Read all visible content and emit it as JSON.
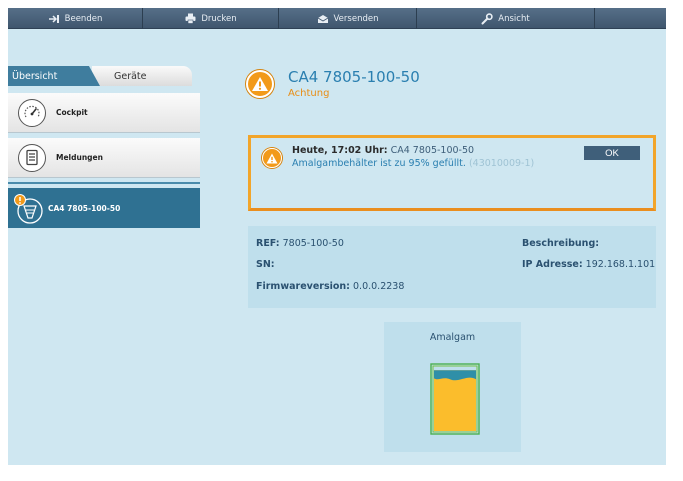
{
  "toolbar": {
    "items": [
      {
        "label": "Beenden",
        "icon": "exit-icon"
      },
      {
        "label": "Drucken",
        "icon": "printer-icon"
      },
      {
        "label": "Versenden",
        "icon": "envelope-icon"
      },
      {
        "label": "Ansicht",
        "icon": "wrench-icon"
      }
    ]
  },
  "sidebar": {
    "tabs": [
      "Übersicht",
      "Geräte"
    ],
    "items": [
      {
        "label": "Cockpit",
        "icon": "gauge-icon"
      },
      {
        "label": "Meldungen",
        "icon": "document-icon"
      },
      {
        "label": "CA4 7805-100-50",
        "icon": "device-icon"
      }
    ]
  },
  "header": {
    "title": "CA4 7805-100-50",
    "status": "Achtung"
  },
  "alert": {
    "time": "Heute, 17:02 Uhr:",
    "device": "CA4 7805-100-50",
    "message": "Amalgambehälter ist zu 95% gefüllt.",
    "code": "(43010009-1)",
    "ok_label": "OK"
  },
  "info": {
    "ref_label": "REF:",
    "ref_value": "7805-100-50",
    "sn_label": "SN:",
    "fw_label": "Firmwareversion:",
    "fw_value": "0.0.0.2238",
    "desc_label": "Beschreibung:",
    "ip_label": "IP Adresse:",
    "ip_value": "192.168.1.101"
  },
  "amalgam": {
    "label": "Amalgam",
    "fill_percent": 95
  },
  "colors": {
    "warning": "#f29a1a",
    "accent": "#2a7fb0",
    "sidebar_active": "#2f7192",
    "background": "#cfe7f1"
  }
}
